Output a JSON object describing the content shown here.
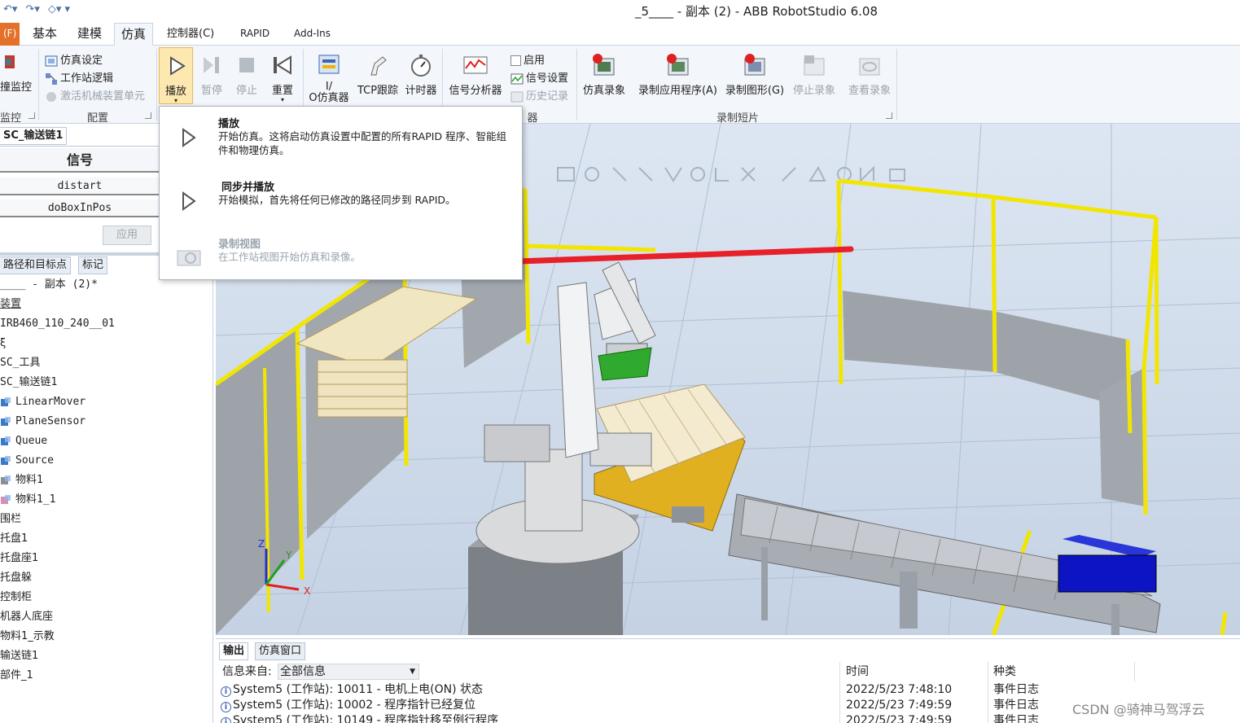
{
  "window": {
    "title": "_5____ - 副本 (2) - ABB RobotStudio 6.08",
    "qat_icons": [
      "undo-icon",
      "redo-icon",
      "customize-qat-icon"
    ]
  },
  "tabs": [
    {
      "label": "(F)",
      "name": "file"
    },
    {
      "label": "基本",
      "name": "basic"
    },
    {
      "label": "建模",
      "name": "modeling"
    },
    {
      "label": "仿真",
      "name": "simulation",
      "active": true
    },
    {
      "label": "控制器(C)",
      "name": "controller"
    },
    {
      "label": "RAPID",
      "name": "rapid"
    },
    {
      "label": "Add-Ins",
      "name": "addins"
    }
  ],
  "ribbon": {
    "collision_monitor": "撞监控",
    "group_monitor": "监控",
    "config_items": [
      "仿真设定",
      "工作站逻辑",
      "激活机械装置单元"
    ],
    "group_config": "配置",
    "play": "播放",
    "pause": "暂停",
    "stop": "停止",
    "reset": "重置",
    "io_sim": "I/\nO仿真器",
    "tcp_trace": "TCP跟踪",
    "timer": "计时器",
    "signal_analyzer": "信号分析器",
    "signal_items": [
      "启用",
      "信号设置",
      "历史记录"
    ],
    "group_signal_partial": "器",
    "record_sim": "仿真录象",
    "record_app": "录制应用程序(A)",
    "record_graphics": "录制图形(G)",
    "stop_record": "停止录象",
    "view_record": "查看录象",
    "group_record": "录制短片"
  },
  "dropdown": {
    "items": [
      {
        "title": "播放",
        "desc": "开始仿真。这将启动仿真设置中配置的所有RAPID 程序、智能组件和物理仿真。",
        "enabled": true
      },
      {
        "title": "同步并播放",
        "desc": "开始模拟，首先将任何已修改的路径同步到 RAPID。",
        "enabled": true
      },
      {
        "title": "录制视图",
        "desc": "在工作站视图开始仿真和录像。",
        "enabled": false
      }
    ]
  },
  "left_panel": {
    "doc_tab": "SC_输送链1",
    "signal_header": "信号",
    "signals": [
      "distart",
      "doBoxInPos"
    ],
    "apply": "应用",
    "tree_tabs": [
      "路径和目标点",
      "标记"
    ],
    "tree": [
      {
        "label": "____ - 副本 (2)*",
        "mono": true
      },
      {
        "label": "装置",
        "link": true
      },
      {
        "label": "IRB460_110_240__01",
        "mono": true
      },
      {
        "label": "ξ"
      },
      {
        "label": "SC_工具",
        "mono": true
      },
      {
        "label": "SC_输送链1",
        "mono": true
      },
      {
        "label": "LinearMover",
        "mono": true,
        "icon": "smart-component-icon"
      },
      {
        "label": "PlaneSensor",
        "mono": true,
        "icon": "smart-component-icon"
      },
      {
        "label": "Queue",
        "mono": true,
        "icon": "smart-component-icon"
      },
      {
        "label": "Source",
        "mono": true,
        "icon": "smart-component-icon"
      },
      {
        "label": "物料1",
        "mono": true,
        "icon": "part-icon"
      },
      {
        "label": "物料1_1",
        "mono": true,
        "icon": "part-pink-icon"
      },
      {
        "label": "围栏"
      },
      {
        "label": "托盘1"
      },
      {
        "label": "托盘座1"
      },
      {
        "label": "托盘躲"
      },
      {
        "label": "控制柜"
      },
      {
        "label": "机器人底座"
      },
      {
        "label": "物料1_示教"
      },
      {
        "label": "输送链1"
      },
      {
        "label": "部件_1"
      }
    ]
  },
  "view3d": {
    "axis_labels": [
      "Z",
      "Y",
      "X"
    ]
  },
  "output": {
    "tabs": [
      "输出",
      "仿真窗口"
    ],
    "source_label": "信息来自:",
    "source_value": "全部信息",
    "col_time": "时间",
    "col_type": "种类",
    "rows": [
      {
        "msg": "System5 (工作站): 10011 - 电机上电(ON) 状态",
        "time": "2022/5/23 7:48:10",
        "type": "事件日志"
      },
      {
        "msg": "System5 (工作站): 10002 - 程序指针已经复位",
        "time": "2022/5/23 7:49:59",
        "type": "事件日志"
      },
      {
        "msg": "System5 (工作站): 10149 - 程序指针移至例行程序",
        "time": "2022/5/23 7:49:59",
        "type": "事件日志"
      }
    ]
  },
  "watermark": "CSDN @骑神马驾浮云",
  "colors": {
    "fence_yellow": "#f2e600",
    "accent_blue": "#2f63b8",
    "arrow_red": "#e8202a",
    "file_tab": "#e5702a"
  }
}
